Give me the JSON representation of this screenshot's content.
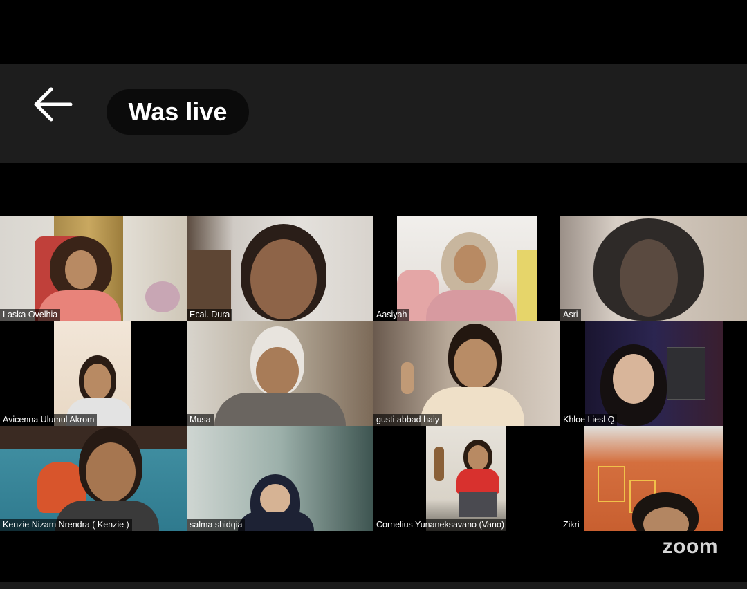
{
  "header": {
    "back_icon": "arrow-left-icon",
    "live_label": "Was live"
  },
  "participants": [
    {
      "name": "Laska Ovelhia"
    },
    {
      "name": "Ecal. Dura"
    },
    {
      "name": "Aasiyah"
    },
    {
      "name": "Asri"
    },
    {
      "name": "Avicenna Ulumul Akrom"
    },
    {
      "name": "Musa"
    },
    {
      "name": "gusti abbad haiy"
    },
    {
      "name": "Khloe Liesl Q"
    },
    {
      "name": "Kenzie Nizam Nrendra ( Kenzie )"
    },
    {
      "name": "salma shidqia"
    },
    {
      "name": "Cornelius Yunaneksavano (Vano)"
    },
    {
      "name": "Zikri"
    }
  ],
  "watermark": "zoom",
  "colors": {
    "background": "#000000",
    "header_bar": "#1d1d1d",
    "pill": "#0b0b0b",
    "text": "#ffffff"
  }
}
